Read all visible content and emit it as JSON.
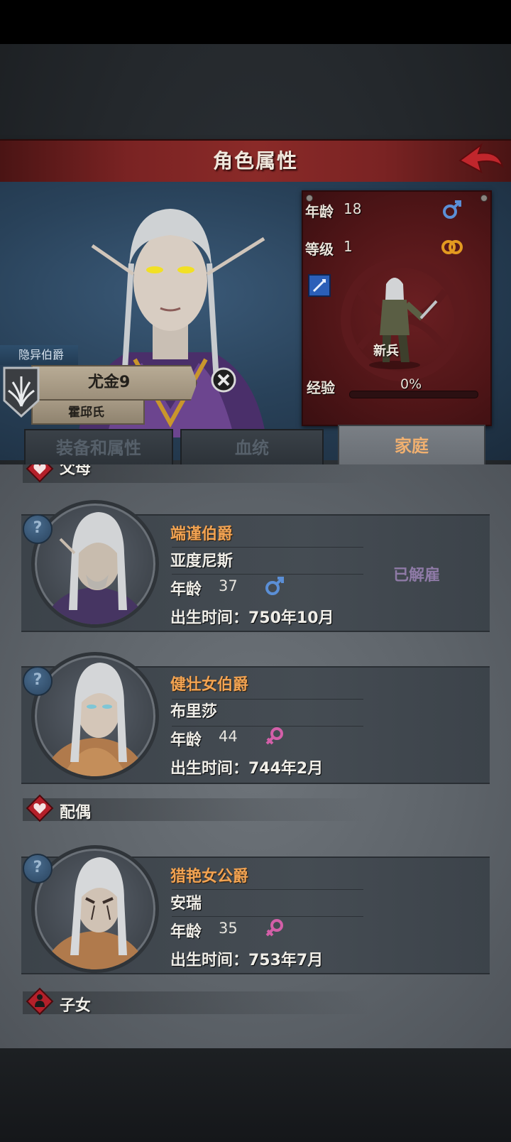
{
  "header": {
    "title": "角色属性"
  },
  "character": {
    "title": "隐异伯爵",
    "name": "尤金9",
    "clan": "霍邱氏",
    "stats": {
      "age_label": "年龄",
      "age": "18",
      "level_label": "等级",
      "level": "1",
      "unit_name": "新兵",
      "exp_label": "经验",
      "exp_percent": "0%"
    },
    "exp_fraction": 0
  },
  "tabs": [
    {
      "label": "装备和属性",
      "active": false
    },
    {
      "label": "血统",
      "active": false
    },
    {
      "label": "家庭",
      "active": true
    }
  ],
  "sections": {
    "parents": "父母",
    "spouse": "配偶",
    "children": "子女"
  },
  "members": [
    {
      "title": "端谨伯爵",
      "name": "亚度尼斯",
      "age_label": "年龄",
      "age": "37",
      "gender": "male",
      "birth": "出生时间：750年10月",
      "status": "已解雇"
    },
    {
      "title": "健壮女伯爵",
      "name": "布里莎",
      "age_label": "年龄",
      "age": "44",
      "gender": "female",
      "birth": "出生时间：744年2月",
      "status": ""
    },
    {
      "title": "猎艳女公爵",
      "name": "安瑞",
      "age_label": "年龄",
      "age": "35",
      "gender": "female",
      "birth": "出生时间：753年7月",
      "status": ""
    }
  ],
  "help_glyph": "?",
  "colors": {
    "accent_orange": "#f2a352",
    "header_red": "#7a2323",
    "male_blue": "#5b8fd6",
    "female_pink": "#d35fa8"
  }
}
